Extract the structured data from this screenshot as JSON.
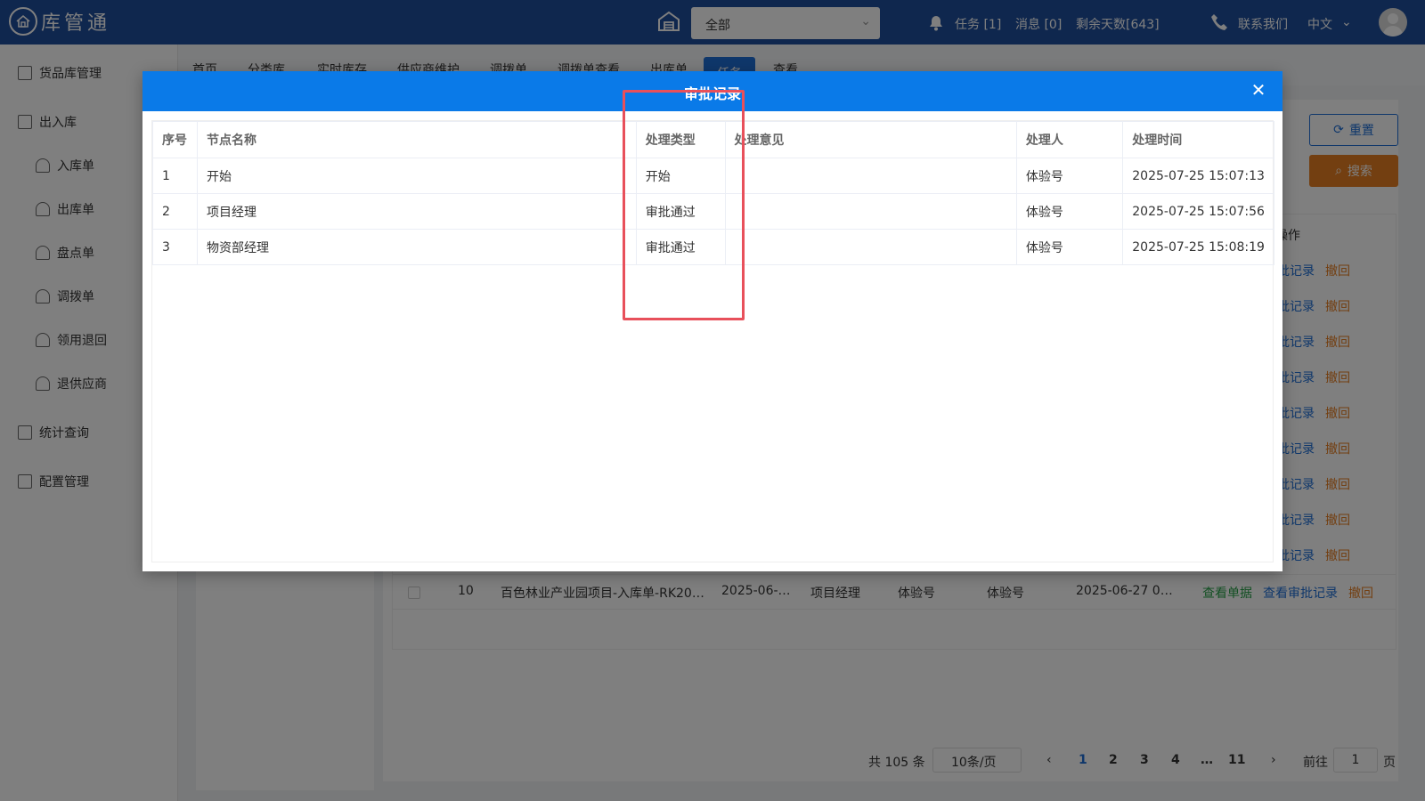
{
  "header": {
    "logo_text": "库管通",
    "scope_select_value": "全部",
    "tasks": "任务 [1]",
    "messages": "消息 [0]",
    "remaining_days": "剩余天数[643]",
    "contact": "联系我们",
    "language": "中文"
  },
  "sidebar": {
    "items": [
      {
        "label": "货品库管理"
      },
      {
        "label": "出入库"
      },
      {
        "label": "入库单"
      },
      {
        "label": "出库单"
      },
      {
        "label": "盘点单"
      },
      {
        "label": "调拨单"
      },
      {
        "label": "领用退回"
      },
      {
        "label": "退供应商"
      },
      {
        "label": "统计查询"
      },
      {
        "label": "配置管理"
      }
    ]
  },
  "tabs": [
    "首页",
    "分类库",
    "实时库存",
    "供应商维护",
    "调拨单",
    "调拨单查看",
    "出库单",
    "任务",
    "查看"
  ],
  "toolbar": {
    "reset_label": "重置",
    "search_label": "搜索"
  },
  "background_table": {
    "op_header": "操作",
    "action_audit": "审批记录",
    "action_withdraw": "撤回",
    "row10": {
      "no": "10",
      "name": "百色林业产业园项目-入库单-RK20…",
      "date": "2025-06-…",
      "node": "项目经理",
      "applicant": "体验号",
      "handler": "体验号",
      "time": "2025-06-27 0…",
      "view": "查看单据",
      "audit": "查看审批记录",
      "withdraw": "撤回"
    }
  },
  "pagination": {
    "total": "共 105 条",
    "page_size": "10条/页",
    "pages": [
      "1",
      "2",
      "3",
      "4",
      "…",
      "11"
    ],
    "goto_prefix": "前往",
    "goto_value": "1",
    "goto_suffix": "页"
  },
  "modal": {
    "title": "审批记录",
    "columns": [
      "序号",
      "节点名称",
      "处理类型",
      "处理意见",
      "处理人",
      "处理时间"
    ],
    "rows": [
      [
        "1",
        "开始",
        "开始",
        "",
        "体验号",
        "2025-07-25 15:07:13"
      ],
      [
        "2",
        "项目经理",
        "审批通过",
        "",
        "体验号",
        "2025-07-25 15:07:56"
      ],
      [
        "3",
        "物资部经理",
        "审批通过",
        "",
        "体验号",
        "2025-07-25 15:08:19"
      ]
    ]
  },
  "colors": {
    "header_bg": "#1f4e9c",
    "modal_header_bg": "#0a7ae8",
    "highlight": "#e8505b",
    "search_button": "#e67e22"
  }
}
